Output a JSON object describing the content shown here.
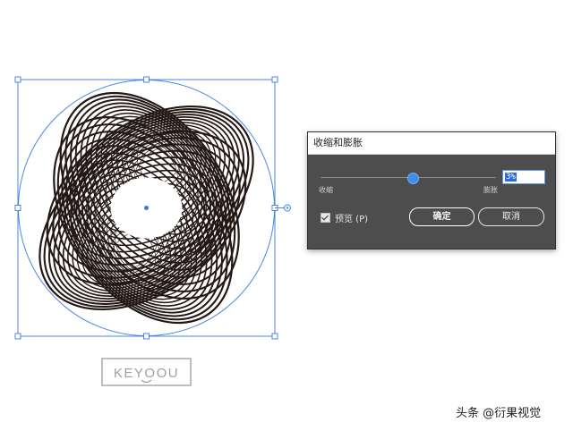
{
  "logo": {
    "text": "KEYOOU"
  },
  "dialog": {
    "title": "收缩和膨胀",
    "slider": {
      "left_label": "收缩",
      "right_label": "膨胀",
      "value": "3%"
    },
    "preview_label": "预览 (P)",
    "preview_checked": true,
    "ok_label": "确定",
    "cancel_label": "取消"
  },
  "watermark": "头条 @衍果视觉",
  "colors": {
    "selection": "#4a86e8",
    "artwork": "#231815",
    "dialog_bg": "#4d4d4d",
    "accent": "#3d8ee8"
  }
}
